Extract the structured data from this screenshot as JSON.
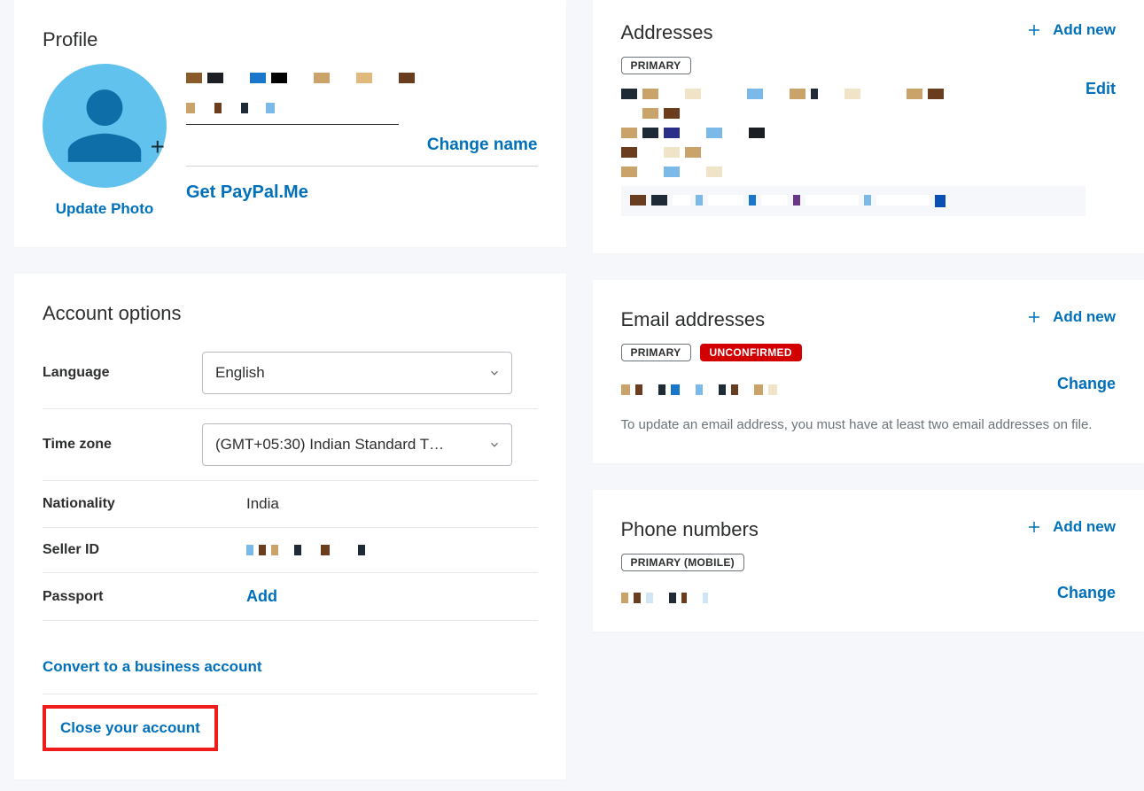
{
  "profile": {
    "title": "Profile",
    "update_photo": "Update Photo",
    "change_name": "Change name",
    "get_paypal_me": "Get PayPal.Me"
  },
  "account_options": {
    "title": "Account options",
    "language_label": "Language",
    "language_value": "English",
    "timezone_label": "Time zone",
    "timezone_value": "(GMT+05:30) Indian Standard T…",
    "nationality_label": "Nationality",
    "nationality_value": "India",
    "seller_id_label": "Seller ID",
    "passport_label": "Passport",
    "passport_action": "Add",
    "convert_business": "Convert to a business account",
    "close_account": "Close your account"
  },
  "addresses": {
    "title": "Addresses",
    "add_new": "Add new",
    "primary_badge": "PRIMARY",
    "edit": "Edit"
  },
  "emails": {
    "title": "Email addresses",
    "add_new": "Add new",
    "primary_badge": "PRIMARY",
    "unconfirmed_badge": "UNCONFIRMED",
    "change": "Change",
    "hint": "To update an email address, you must have at least two email addresses on file."
  },
  "phones": {
    "title": "Phone numbers",
    "add_new": "Add new",
    "primary_badge": "PRIMARY (MOBILE)",
    "change": "Change"
  }
}
